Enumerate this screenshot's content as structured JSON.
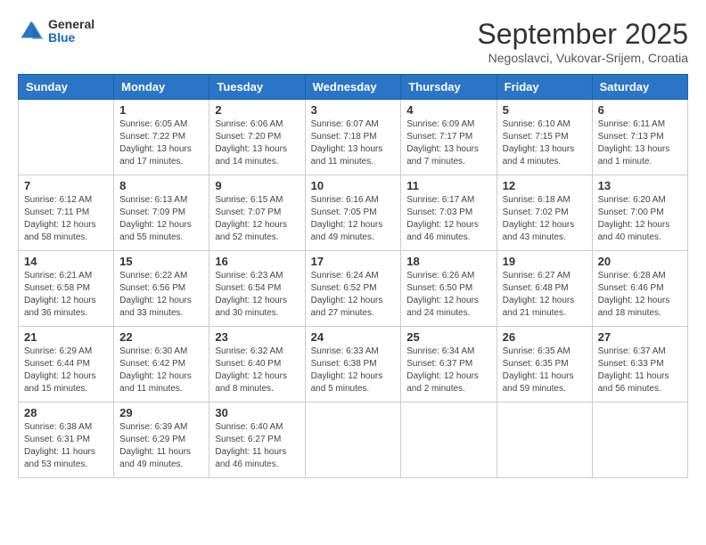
{
  "header": {
    "logo": {
      "general": "General",
      "blue": "Blue"
    },
    "title": "September 2025",
    "location": "Negoslavci, Vukovar-Srijem, Croatia"
  },
  "days_of_week": [
    "Sunday",
    "Monday",
    "Tuesday",
    "Wednesday",
    "Thursday",
    "Friday",
    "Saturday"
  ],
  "weeks": [
    [
      {
        "day": "",
        "content": ""
      },
      {
        "day": "1",
        "content": "Sunrise: 6:05 AM\nSunset: 7:22 PM\nDaylight: 13 hours\nand 17 minutes."
      },
      {
        "day": "2",
        "content": "Sunrise: 6:06 AM\nSunset: 7:20 PM\nDaylight: 13 hours\nand 14 minutes."
      },
      {
        "day": "3",
        "content": "Sunrise: 6:07 AM\nSunset: 7:18 PM\nDaylight: 13 hours\nand 11 minutes."
      },
      {
        "day": "4",
        "content": "Sunrise: 6:09 AM\nSunset: 7:17 PM\nDaylight: 13 hours\nand 7 minutes."
      },
      {
        "day": "5",
        "content": "Sunrise: 6:10 AM\nSunset: 7:15 PM\nDaylight: 13 hours\nand 4 minutes."
      },
      {
        "day": "6",
        "content": "Sunrise: 6:11 AM\nSunset: 7:13 PM\nDaylight: 13 hours\nand 1 minute."
      }
    ],
    [
      {
        "day": "7",
        "content": "Sunrise: 6:12 AM\nSunset: 7:11 PM\nDaylight: 12 hours\nand 58 minutes."
      },
      {
        "day": "8",
        "content": "Sunrise: 6:13 AM\nSunset: 7:09 PM\nDaylight: 12 hours\nand 55 minutes."
      },
      {
        "day": "9",
        "content": "Sunrise: 6:15 AM\nSunset: 7:07 PM\nDaylight: 12 hours\nand 52 minutes."
      },
      {
        "day": "10",
        "content": "Sunrise: 6:16 AM\nSunset: 7:05 PM\nDaylight: 12 hours\nand 49 minutes."
      },
      {
        "day": "11",
        "content": "Sunrise: 6:17 AM\nSunset: 7:03 PM\nDaylight: 12 hours\nand 46 minutes."
      },
      {
        "day": "12",
        "content": "Sunrise: 6:18 AM\nSunset: 7:02 PM\nDaylight: 12 hours\nand 43 minutes."
      },
      {
        "day": "13",
        "content": "Sunrise: 6:20 AM\nSunset: 7:00 PM\nDaylight: 12 hours\nand 40 minutes."
      }
    ],
    [
      {
        "day": "14",
        "content": "Sunrise: 6:21 AM\nSunset: 6:58 PM\nDaylight: 12 hours\nand 36 minutes."
      },
      {
        "day": "15",
        "content": "Sunrise: 6:22 AM\nSunset: 6:56 PM\nDaylight: 12 hours\nand 33 minutes."
      },
      {
        "day": "16",
        "content": "Sunrise: 6:23 AM\nSunset: 6:54 PM\nDaylight: 12 hours\nand 30 minutes."
      },
      {
        "day": "17",
        "content": "Sunrise: 6:24 AM\nSunset: 6:52 PM\nDaylight: 12 hours\nand 27 minutes."
      },
      {
        "day": "18",
        "content": "Sunrise: 6:26 AM\nSunset: 6:50 PM\nDaylight: 12 hours\nand 24 minutes."
      },
      {
        "day": "19",
        "content": "Sunrise: 6:27 AM\nSunset: 6:48 PM\nDaylight: 12 hours\nand 21 minutes."
      },
      {
        "day": "20",
        "content": "Sunrise: 6:28 AM\nSunset: 6:46 PM\nDaylight: 12 hours\nand 18 minutes."
      }
    ],
    [
      {
        "day": "21",
        "content": "Sunrise: 6:29 AM\nSunset: 6:44 PM\nDaylight: 12 hours\nand 15 minutes."
      },
      {
        "day": "22",
        "content": "Sunrise: 6:30 AM\nSunset: 6:42 PM\nDaylight: 12 hours\nand 11 minutes."
      },
      {
        "day": "23",
        "content": "Sunrise: 6:32 AM\nSunset: 6:40 PM\nDaylight: 12 hours\nand 8 minutes."
      },
      {
        "day": "24",
        "content": "Sunrise: 6:33 AM\nSunset: 6:38 PM\nDaylight: 12 hours\nand 5 minutes."
      },
      {
        "day": "25",
        "content": "Sunrise: 6:34 AM\nSunset: 6:37 PM\nDaylight: 12 hours\nand 2 minutes."
      },
      {
        "day": "26",
        "content": "Sunrise: 6:35 AM\nSunset: 6:35 PM\nDaylight: 11 hours\nand 59 minutes."
      },
      {
        "day": "27",
        "content": "Sunrise: 6:37 AM\nSunset: 6:33 PM\nDaylight: 11 hours\nand 56 minutes."
      }
    ],
    [
      {
        "day": "28",
        "content": "Sunrise: 6:38 AM\nSunset: 6:31 PM\nDaylight: 11 hours\nand 53 minutes."
      },
      {
        "day": "29",
        "content": "Sunrise: 6:39 AM\nSunset: 6:29 PM\nDaylight: 11 hours\nand 49 minutes."
      },
      {
        "day": "30",
        "content": "Sunrise: 6:40 AM\nSunset: 6:27 PM\nDaylight: 11 hours\nand 46 minutes."
      },
      {
        "day": "",
        "content": ""
      },
      {
        "day": "",
        "content": ""
      },
      {
        "day": "",
        "content": ""
      },
      {
        "day": "",
        "content": ""
      }
    ]
  ]
}
